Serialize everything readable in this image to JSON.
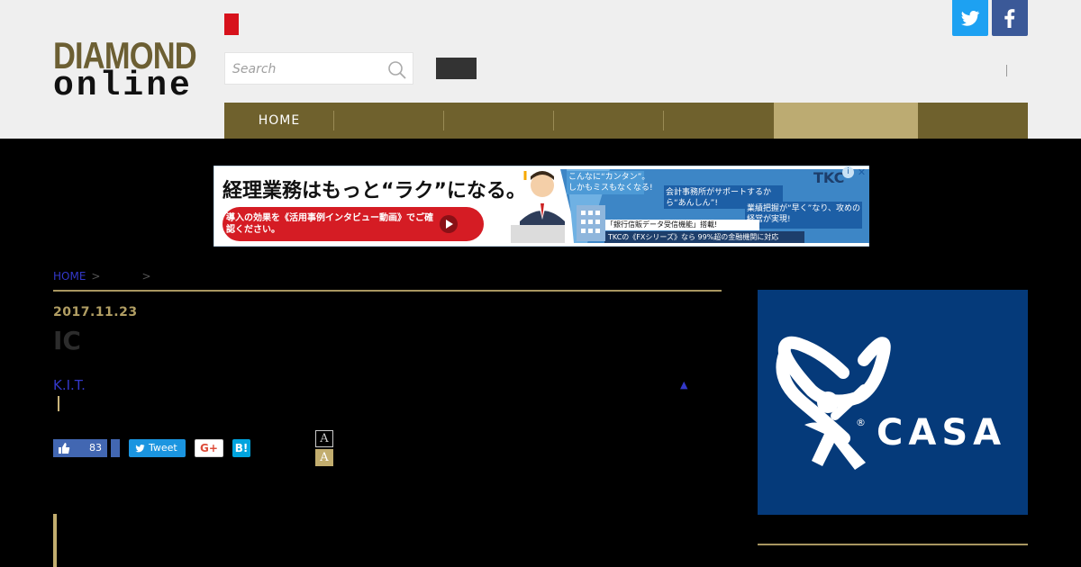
{
  "header": {
    "logo_line1": "DIAMOND",
    "logo_line2": "online",
    "search_placeholder": "Search",
    "social": {
      "twitter": "twitter-icon",
      "facebook": "facebook-icon"
    },
    "divider": "|"
  },
  "nav": {
    "items": [
      {
        "label": "HOME"
      },
      {
        "label": ""
      },
      {
        "label": ""
      },
      {
        "label": ""
      },
      {
        "label": ""
      },
      {
        "label": "",
        "active": true
      },
      {
        "label": ""
      }
    ]
  },
  "ad_banner": {
    "headline": "経理業務はもっと“ラク”になる。",
    "cta": "導入の効果を《活用事例インタビュー動画》でご確認ください。",
    "bubble1": "こんなに“カンタン”。しかもミスもなくなる!",
    "bubble2": "会計事務所がサポートするから“あんしん”!",
    "bubble3": "業績把握が“早く”なり、攻めの経営が実現!",
    "feature": "「銀行信販データ受信機能」搭載!",
    "footer": "TKCの《FXシリーズ》なら 99%超の金融機関に対応",
    "brand": "TKC"
  },
  "breadcrumb": {
    "home": "HOME",
    "sep": ">"
  },
  "article": {
    "date": "2017.11.23",
    "title": "IC",
    "author": "K.I.T.",
    "author_toggle": "▲",
    "like_count": "83",
    "tweet_label": "Tweet",
    "gplus_label": "G+",
    "hatena_label": "B!",
    "font_small": "A",
    "font_large": "A"
  },
  "sidebar_ad": {
    "brand": "CASA",
    "mark": "®"
  },
  "colors": {
    "nav_bg": "#6f612d",
    "nav_active": "#bcab72",
    "accent_gold": "#b19e63",
    "link": "#3338c9",
    "red": "#d7121c",
    "sidebar_blue": "#053a7a"
  }
}
